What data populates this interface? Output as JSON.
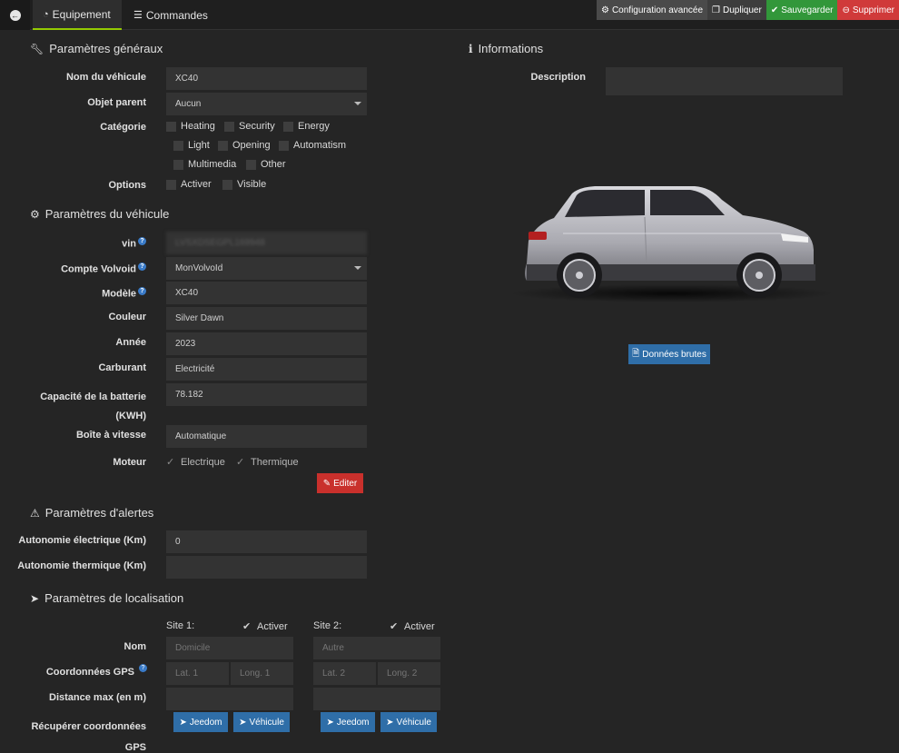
{
  "toolbar": {
    "tabs": [
      {
        "label": "Equipement",
        "icon": "gauge-icon"
      },
      {
        "label": "Commandes",
        "icon": "list-icon"
      }
    ],
    "actions": {
      "advanced": "Configuration avancée",
      "duplicate": "Dupliquer",
      "save": "Sauvegarder",
      "delete": "Supprimer"
    }
  },
  "general": {
    "title": "Paramètres généraux",
    "vehicle_name_label": "Nom du véhicule",
    "vehicle_name_value": "XC40",
    "parent_label": "Objet parent",
    "parent_value": "Aucun",
    "category_label": "Catégorie",
    "categories": [
      "Heating",
      "Security",
      "Energy",
      "Light",
      "Opening",
      "Automatism",
      "Multimedia",
      "Other"
    ],
    "options_label": "Options",
    "options": [
      "Activer",
      "Visible"
    ]
  },
  "info": {
    "title": "Informations",
    "description_label": "Description",
    "description_value": "",
    "raw_data_button": "Données brutes"
  },
  "vehicle": {
    "title": "Paramètres du véhicule",
    "vin_label": "vin",
    "vin_value": "LVSXDSEGPL169948",
    "account_label": "Compte Volvoid",
    "account_value": "MonVolvoId",
    "model_label": "Modèle",
    "model_value": "XC40",
    "color_label": "Couleur",
    "color_value": "Silver Dawn",
    "year_label": "Année",
    "year_value": "2023",
    "fuel_label": "Carburant",
    "fuel_value": "Electricité",
    "battery_label_line1": "Capacité de la batterie",
    "battery_label_line2": "(KWH)",
    "battery_value": "78.182",
    "gearbox_label": "Boîte à vitesse",
    "gearbox_value": "Automatique",
    "engine_label": "Moteur",
    "engine_options": [
      "Electrique",
      "Thermique"
    ],
    "edit_button": "Editer"
  },
  "alerts": {
    "title": "Paramètres d'alertes",
    "electric_range_label": "Autonomie électrique (Km)",
    "electric_range_value": "0",
    "thermal_range_label": "Autonomie thermique (Km)",
    "thermal_range_value": ""
  },
  "location": {
    "title": "Paramètres de localisation",
    "name_label": "Nom",
    "gps_label": "Coordonnées GPS",
    "maxdist_label": "Distance max (en m)",
    "fetch_label_line1": "Récupérer coordonnées",
    "fetch_label_line2": "GPS",
    "activate_label": "Activer",
    "jeedom_button": "Jeedom",
    "vehicle_button": "Véhicule",
    "sites": [
      {
        "title": "Site 1:",
        "name_placeholder": "Domicile",
        "lat_placeholder": "Lat. 1",
        "long_placeholder": "Long. 1"
      },
      {
        "title": "Site 2:",
        "name_placeholder": "Autre",
        "lat_placeholder": "Lat. 2",
        "long_placeholder": "Long. 2"
      }
    ]
  },
  "colors": {
    "accent_tab": "#94ca02",
    "save": "#32973a",
    "delete": "#d03a3a",
    "primary": "#2f6ea8",
    "edit": "#c9302c"
  }
}
